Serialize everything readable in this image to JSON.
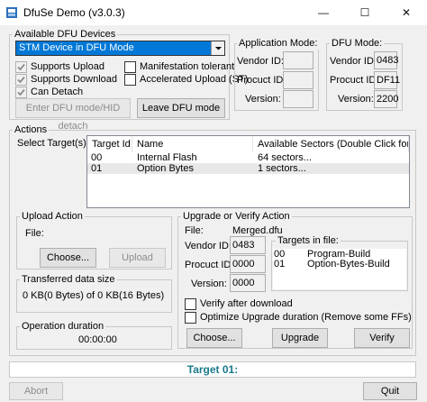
{
  "window": {
    "title": "DfuSe Demo (v3.0.3)",
    "minimize": "—",
    "maximize": "☐",
    "close": "✕"
  },
  "available_devices": {
    "legend": "Available DFU Devices",
    "selected_device": "STM Device in DFU Mode",
    "checkboxes": {
      "supports_upload": "Supports Upload",
      "supports_download": "Supports Download",
      "can_detach": "Can Detach",
      "manifestation_tolerant": "Manifestation tolerant",
      "accelerated_upload": "Accelerated Upload (ST)"
    },
    "enter_dfu_label": "Enter DFU mode/HID detach",
    "leave_dfu_label": "Leave DFU mode"
  },
  "application_mode": {
    "legend": "Application Mode:",
    "vendor_label": "Vendor ID:",
    "product_label": "Procuct ID:",
    "version_label": "Version:",
    "vendor_value": "",
    "product_value": "",
    "version_value": ""
  },
  "dfu_mode": {
    "legend": "DFU Mode:",
    "vendor_label": "Vendor ID:",
    "product_label": "Procuct ID:",
    "version_label": "Version:",
    "vendor_value": "0483",
    "product_value": "DF11",
    "version_value": "2200"
  },
  "actions": {
    "legend": "Actions",
    "select_targets_label": "Select Target(s):",
    "columns": [
      "Target Id",
      "Name",
      "Available Sectors (Double Click for more)"
    ],
    "rows": [
      {
        "id": "00",
        "name": "Internal Flash",
        "sectors": "64 sectors..."
      },
      {
        "id": "01",
        "name": "Option Bytes",
        "sectors": "1 sectors..."
      }
    ]
  },
  "upload_action": {
    "legend": "Upload Action",
    "file_label": "File:",
    "file_value": "",
    "choose_label": "Choose...",
    "upload_label": "Upload"
  },
  "transferred": {
    "legend": "Transferred data size",
    "value": "0 KB(0 Bytes) of 0 KB(16 Bytes)"
  },
  "operation_duration": {
    "legend": "Operation duration",
    "value": "00:00:00"
  },
  "upgrade_verify": {
    "legend": "Upgrade or Verify Action",
    "file_label": "File:",
    "file_value": "Merged.dfu",
    "vendor_label": "Vendor ID:",
    "vendor_value": "0483",
    "product_label": "Procuct ID:",
    "product_value": "0000",
    "version_label": "Version:",
    "version_value": "0000",
    "targets_in_file_label": "Targets in file:",
    "targets": [
      {
        "id": "00",
        "name": "Program-Build"
      },
      {
        "id": "01",
        "name": "Option-Bytes-Build"
      }
    ],
    "verify_after_download": "Verify after download",
    "optimize_upgrade": "Optimize Upgrade duration (Remove some FFs)",
    "choose_label": "Choose...",
    "upgrade_label": "Upgrade",
    "verify_label": "Verify"
  },
  "status": {
    "text": "Target 01:",
    "color": "#1a7a8a"
  },
  "footer": {
    "abort_label": "Abort",
    "quit_label": "Quit"
  }
}
